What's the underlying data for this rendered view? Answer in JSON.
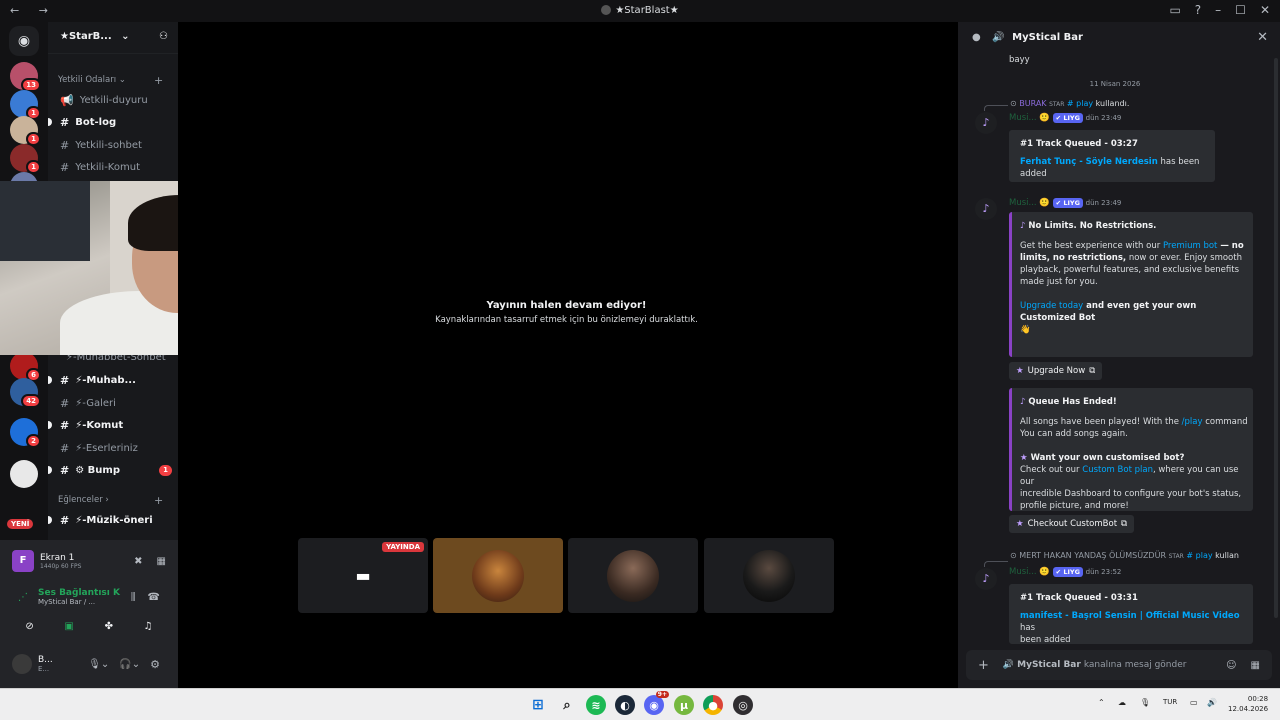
{
  "window": {
    "title": "★StarBlast★",
    "nav": "← →"
  },
  "server": {
    "name": "★StarB...",
    "new_badge": "YENİ"
  },
  "rail_servers": [
    {
      "badge": "13",
      "color": "#b8506a"
    },
    {
      "badge": "1",
      "color": "#3a7bd5"
    },
    {
      "badge": "1",
      "color": "#c9b39a"
    },
    {
      "badge": "1",
      "color": "#8a2a2a"
    },
    {
      "badge": "3",
      "color": "#6b7aa8"
    },
    {
      "badge": "6",
      "color": "#b01c1c"
    },
    {
      "badge": "42",
      "color": "#2f5f9e"
    },
    {
      "badge": "2",
      "color": "#1e6fd9"
    },
    {
      "badge": "",
      "color": "#e8e8e8"
    }
  ],
  "categories": {
    "yetkili": "Yetkili Odaları",
    "eglenceler": "Eğlenceler"
  },
  "channels_top": [
    {
      "name": "Yetkili-duyuru",
      "icon": "📢",
      "unread": false
    },
    {
      "name": "Bot-log",
      "icon": "#",
      "unread": true
    },
    {
      "name": "Yetkili-sohbet",
      "icon": "#",
      "unread": false
    },
    {
      "name": "Yetkili-Komut",
      "icon": "#",
      "unread": false
    }
  ],
  "channels_mid": [
    {
      "name": "⚡-Muhabbet-Sohbet",
      "icon": "",
      "unread": false
    },
    {
      "name": "⚡-Muhab...",
      "icon": "#",
      "unread": true
    },
    {
      "name": "⚡-Galeri",
      "icon": "#",
      "unread": false
    },
    {
      "name": "⚡-Komut",
      "icon": "#",
      "unread": true
    },
    {
      "name": "⚡-Eserleriniz",
      "icon": "#",
      "unread": false
    },
    {
      "name": "⚙ Bump",
      "icon": "#",
      "unread": true,
      "badge": "1"
    }
  ],
  "channels_bottom": [
    {
      "name": "⚡-Müzik-öneri",
      "icon": "#",
      "unread": true
    }
  ],
  "stream": {
    "screen_name": "Ekran 1",
    "quality": "1440p 60 FPS",
    "voice_status": "Ses Bağlantısı K",
    "voice_channel": "MyStical Bar / ..."
  },
  "user": {
    "name": "B...",
    "status": "E..."
  },
  "stage": {
    "title": "Yayının halen devam ediyor!",
    "subtitle": "Kaynaklarından tasarruf etmek için bu önizlemeyi duraklattık.",
    "live_label": "YAYINDA"
  },
  "panel": {
    "title": "MyStical Bar",
    "top_text": "bayy",
    "date_divider": "11 Nisan 2026",
    "msg1": {
      "reply_user": "BURAK",
      "reply_tag": "STAR",
      "reply_cmd": "# play",
      "reply_tail": "kullandı.",
      "author": "Musi...",
      "role": "✔ LIYG",
      "time": "dün 23:49",
      "embed_title": "#1 Track Queued - 03:27",
      "embed_link": "Ferhat Tunç - Söyle Nerdesin",
      "embed_tail": "has been added"
    },
    "msg2": {
      "author": "Musi...",
      "role": "✔ LIYG",
      "time": "dün 23:49",
      "promo_title": "No Limits. No Restrictions.",
      "promo_l1a": "Get the best experience with our ",
      "promo_l1link": "Premium bot",
      "promo_l1b": " — no",
      "promo_l2a": "limits, no restrictions,",
      "promo_l2b": " now or ever. Enjoy smooth",
      "promo_l3": "playback, powerful features, and exclusive benefits",
      "promo_l4": "made just for you.",
      "promo_upgrade_link": "Upgrade today",
      "promo_upgrade_tail": " and even get your own Customized Bot",
      "promo_emoji": "👋",
      "upgrade_button": "Upgrade Now",
      "queue_title": "Queue Has Ended!",
      "queue_l1a": "All songs have been played! With the ",
      "queue_l1link": "/play",
      "queue_l1b": " command",
      "queue_l2": "You can add songs again.",
      "custom_title": "Want your own customised bot?",
      "custom_l1a": "Check out our ",
      "custom_l1link": "Custom Bot plan",
      "custom_l1b": ", where you can use our",
      "custom_l2": "incredible Dashboard to configure your bot's status,",
      "custom_l3": "profile picture, and more!",
      "checkout_button": "Checkout CustomBot"
    },
    "msg3": {
      "reply_user": "MERT HAKAN YANDAŞ ÖLÜMSÜZDÜR",
      "reply_tag": "STAR",
      "reply_cmd": "# play",
      "reply_tail": "kullan",
      "author": "Musi...",
      "role": "✔ LIYG",
      "time": "dün 23:52",
      "embed_title": "#1 Track Queued - 03:31",
      "embed_link1": "manifest - Başrol Sensin | Official Music Video",
      "embed_tail1": "has",
      "embed_tail2": "been added"
    },
    "input_channel": "MyStical Bar",
    "input_placeholder": "kanalına mesaj gönder"
  },
  "taskbar": {
    "lang": "TUR",
    "time": "00:28",
    "date": "12.04.2026",
    "discord_badge": "9+"
  },
  "colors": {
    "accent": "#5865f2",
    "danger": "#da373c",
    "embed_purple": "#8a42c6"
  }
}
